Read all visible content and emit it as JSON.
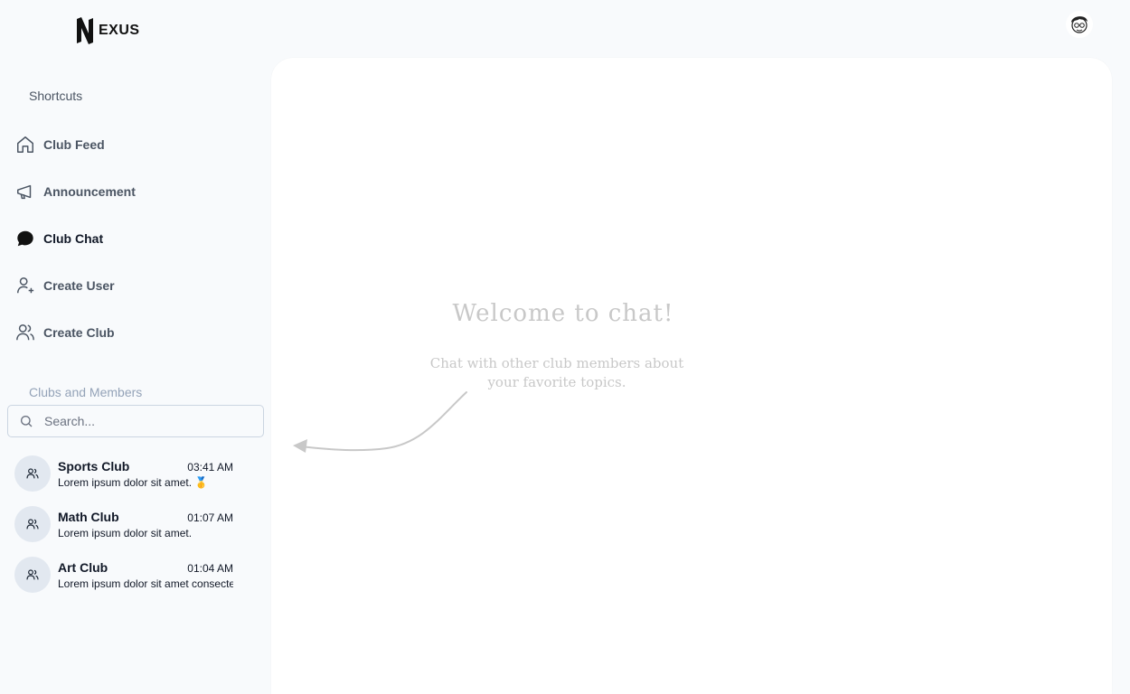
{
  "header": {
    "logo_text": "EXUS",
    "logo_icon": "nexus-n-logo",
    "avatar_icon": "user-avatar"
  },
  "sidebar": {
    "shortcuts_title": "Shortcuts",
    "items": [
      {
        "label": "Club Feed",
        "icon": "home-icon",
        "active": false
      },
      {
        "label": "Announcement",
        "icon": "megaphone-icon",
        "active": false
      },
      {
        "label": "Club Chat",
        "icon": "chat-bubble-icon",
        "active": true
      },
      {
        "label": "Create User",
        "icon": "user-plus-icon",
        "active": false
      },
      {
        "label": "Create Club",
        "icon": "users-icon",
        "active": false
      }
    ],
    "clubs_title": "Clubs and Members",
    "search": {
      "placeholder": "Search...",
      "value": ""
    },
    "clubs": [
      {
        "name": "Sports Club",
        "time": "03:41 AM",
        "message": "Lorem ipsum dolor sit amet. 🥇"
      },
      {
        "name": "Math Club",
        "time": "01:07 AM",
        "message": "Lorem ipsum dolor sit amet."
      },
      {
        "name": "Art Club",
        "time": "01:04 AM",
        "message": "Lorem ipsum dolor sit amet consectetur"
      }
    ]
  },
  "main": {
    "welcome_title": "Welcome to chat!",
    "welcome_subtitle": "Chat with other club members about your favorite topics."
  },
  "colors": {
    "background": "#f8fafc",
    "panel": "#ffffff",
    "accent_text": "#111827",
    "muted_text": "#4b5563",
    "hint_text": "#c8c8c8"
  }
}
